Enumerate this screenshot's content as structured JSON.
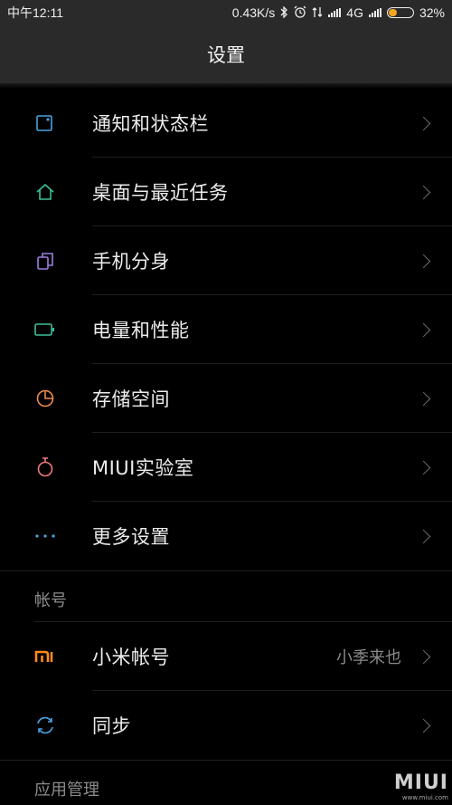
{
  "status_bar": {
    "time": "中午12:11",
    "speed": "0.43K/s",
    "network": "4G",
    "battery": "32%",
    "battery_level": 0.32,
    "battery_color": "#f5a623"
  },
  "header": {
    "title": "设置"
  },
  "items_group1": [
    {
      "label": "通知和状态栏",
      "icon": "notification-icon",
      "color": "#4aa3df"
    },
    {
      "label": "桌面与最近任务",
      "icon": "home-icon",
      "color": "#3dbf9b"
    },
    {
      "label": "手机分身",
      "icon": "dual-phone-icon",
      "color": "#9b7fe0"
    },
    {
      "label": "电量和性能",
      "icon": "battery-icon",
      "color": "#3dbf9b"
    },
    {
      "label": "存储空间",
      "icon": "pie-storage-icon",
      "color": "#f08a4b"
    },
    {
      "label": "MIUI实验室",
      "icon": "flask-icon",
      "color": "#f07a7a"
    },
    {
      "label": "更多设置",
      "icon": "more-dots-icon",
      "color": "#4aa3df"
    }
  ],
  "section_account": {
    "label": "帐号"
  },
  "items_group2": [
    {
      "label": "小米帐号",
      "value": "小季来也",
      "icon": "mi-logo-icon",
      "color": "#ff8a1e"
    },
    {
      "label": "同步",
      "value": "",
      "icon": "sync-icon",
      "color": "#4aa3df"
    }
  ],
  "section_apps": {
    "label": "应用管理"
  },
  "watermark": {
    "brand": "MIUI",
    "site": "www.miui.com"
  }
}
